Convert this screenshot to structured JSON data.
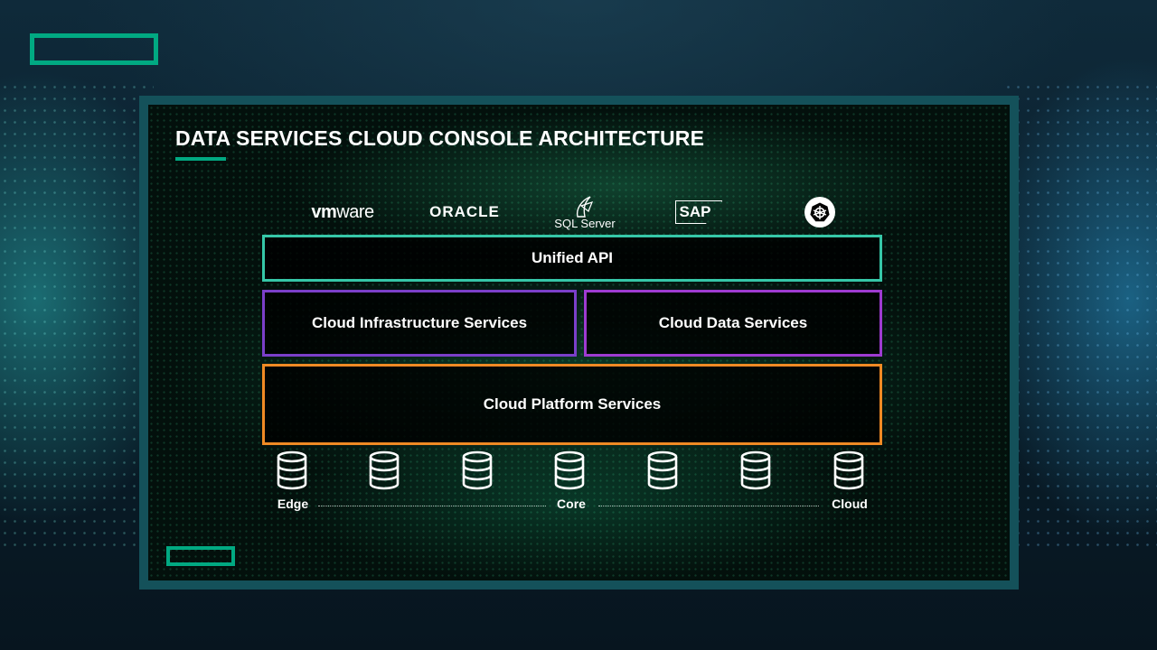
{
  "title": "DATA SERVICES CLOUD CONSOLE ARCHITECTURE",
  "logos": {
    "vmware_prefix": "vm",
    "vmware_suffix": "ware",
    "oracle": "ORACLE",
    "sql_server": "SQL Server",
    "sap": "SAP"
  },
  "layers": {
    "unified_api": "Unified API",
    "cloud_infrastructure": "Cloud Infrastructure Services",
    "cloud_data": "Cloud Data Services",
    "cloud_platform": "Cloud Platform Services"
  },
  "tiers": {
    "edge": "Edge",
    "core": "Core",
    "cloud": "Cloud"
  },
  "colors": {
    "brand_green": "#01a982",
    "api_border": "#36c7a8",
    "infra_border": "#7b3fc9",
    "data_border": "#9e3bd1",
    "platform_border": "#f08a24",
    "frame": "#14515a"
  },
  "icons": [
    "database-icon",
    "kubernetes-icon",
    "sql-server-icon"
  ]
}
